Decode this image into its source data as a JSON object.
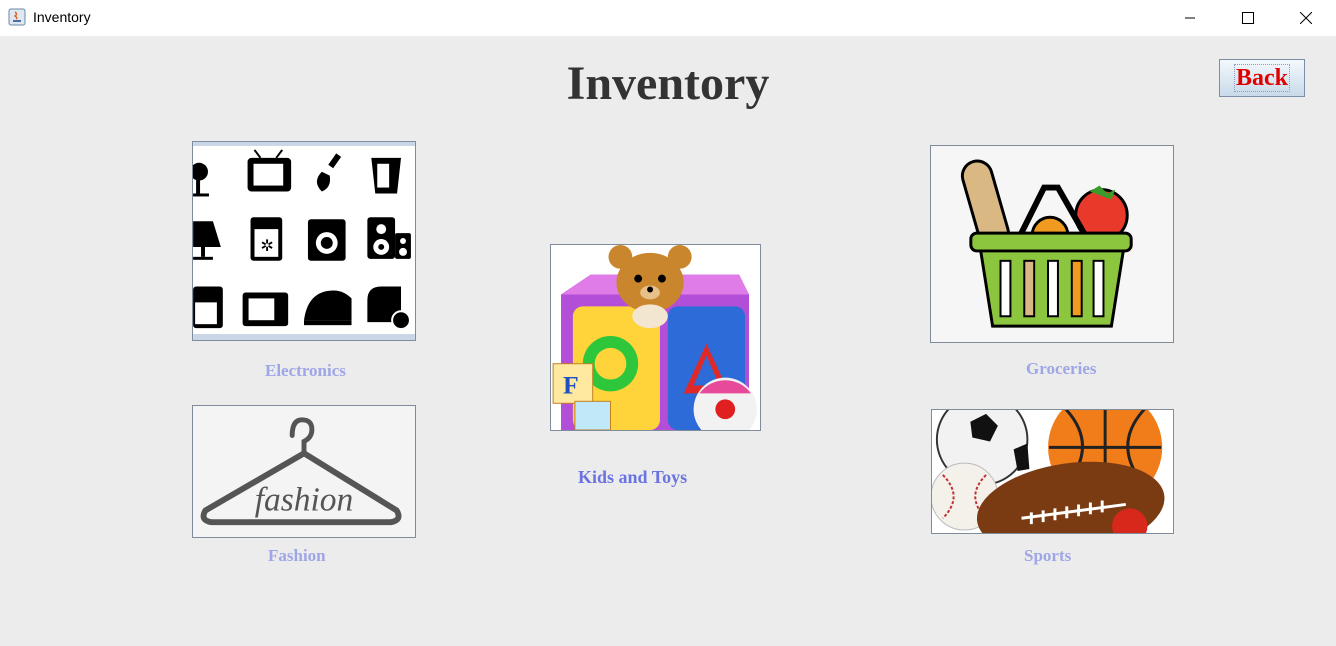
{
  "window": {
    "title": "Inventory",
    "controls": [
      "minimize-icon",
      "maximize-icon",
      "close-icon"
    ]
  },
  "page": {
    "heading": "Inventory",
    "back_label": "Back"
  },
  "categories": [
    {
      "label": "Electronics",
      "icon": "electronics-image"
    },
    {
      "label": "Kids and Toys",
      "icon": "toys-image"
    },
    {
      "label": "Groceries",
      "icon": "groceries-image"
    },
    {
      "label": "Fashion",
      "icon": "fashion-image"
    },
    {
      "label": "Sports",
      "icon": "sports-image"
    }
  ],
  "colors": {
    "background": "#ececec",
    "heading": "#333333",
    "back_text": "#e00000",
    "category_label": "#9ea6e8",
    "category_label_active": "#6b73e0"
  }
}
